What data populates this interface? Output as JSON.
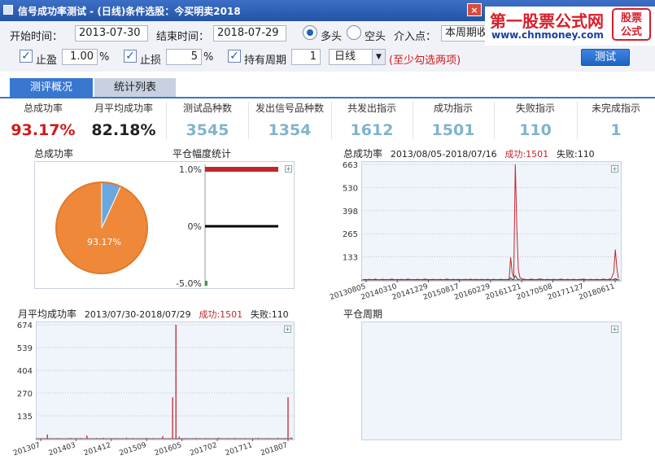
{
  "window": {
    "title": "信号成功率测试 - (日线)条件选股：今买明卖2018",
    "close_glyph": "×"
  },
  "logo": {
    "name": "第一股票公式网",
    "url": "www.chnmoney.com",
    "stamp_l1": "股票",
    "stamp_l2": "公式"
  },
  "form": {
    "start_label": "开始时间：",
    "start_value": "2013-07-30",
    "end_label": "结束时间：",
    "end_value": "2018-07-29",
    "long_label": "多头",
    "short_label": "空头",
    "entry_label": "介入点：",
    "entry_value": "本周期收",
    "take_profit_label": "止盈",
    "take_profit_value": "1.00",
    "take_profit_unit": "%",
    "stop_loss_label": "止损",
    "stop_loss_value": "5",
    "stop_loss_unit": "%",
    "hold_label": "持有周期",
    "hold_value": "1",
    "period_value": "日线",
    "note": "(至少勾选两项)",
    "test_button": "测试",
    "check_mark": "✓",
    "dropdown_glyph": "▼"
  },
  "tabs": [
    {
      "label": "测评概况"
    },
    {
      "label": "统计列表"
    }
  ],
  "stats": [
    {
      "label": "总成功率",
      "value": "93.17%",
      "color": "#d11a1a"
    },
    {
      "label": "月平均成功率",
      "value": "82.18%",
      "color": "#222222"
    },
    {
      "label": "测试品种数",
      "value": "3545",
      "color": "#7fb4cf"
    },
    {
      "label": "发出信号品种数",
      "value": "1354",
      "color": "#7fb4cf"
    },
    {
      "label": "共发出指示",
      "value": "1612",
      "color": "#7fb4cf"
    },
    {
      "label": "成功指示",
      "value": "1501",
      "color": "#7fb4cf"
    },
    {
      "label": "失败指示",
      "value": "110",
      "color": "#7fb4cf"
    },
    {
      "label": "未完成指示",
      "value": "1",
      "color": "#7fb4cf"
    }
  ],
  "panels": {
    "pie_title": "总成功率",
    "range_title": "平仓幅度统计",
    "daily_title": "总成功率",
    "daily_range": "2013/08/05-2018/07/16",
    "monthly_title": "月平均成功率",
    "monthly_range": "2013/07/30-2018/07/29",
    "success_label": "成功:1501",
    "fail_label": "失败:110",
    "period_title": "平仓周期",
    "plus_glyph": "+"
  },
  "chart_data": [
    {
      "type": "pie",
      "categories": [
        "成功",
        "失败"
      ],
      "values": [
        93.17,
        6.83
      ],
      "colors": [
        "#f0883a",
        "#6aa7de"
      ],
      "label": "93.17%"
    },
    {
      "type": "bar",
      "title": "平仓幅度统计",
      "y_ticks": [
        "1.0%",
        "0%",
        "-5.0%"
      ],
      "series": [
        {
          "values": [
            1.0,
            0,
            -5.0
          ]
        }
      ],
      "colors": [
        "#c0272d",
        "#000000",
        "#2ea043"
      ]
    },
    {
      "type": "line",
      "title": "总成功率",
      "y_ticks": [
        663,
        530,
        398,
        265,
        133
      ],
      "ylim": [
        0,
        663
      ],
      "x_ticks": [
        "20130805",
        "20140310",
        "20141229",
        "20150817",
        "20160229",
        "20161121",
        "20170508",
        "20171127",
        "20180611"
      ],
      "series": [
        {
          "name": "成功",
          "color": "#c0272d",
          "values": [
            2,
            3,
            3,
            2,
            4,
            3,
            2,
            3,
            5,
            3,
            2,
            2,
            3,
            4,
            3,
            2,
            3,
            2,
            4,
            5,
            3,
            2,
            3,
            3,
            2,
            4,
            3,
            2,
            3,
            5,
            4,
            3,
            2,
            3,
            2,
            4,
            3,
            3,
            2,
            3,
            5,
            4,
            3,
            2,
            3,
            3,
            4,
            2,
            3,
            2,
            4,
            3,
            2,
            3,
            4,
            5,
            3,
            2,
            3,
            4,
            2,
            3,
            4,
            3,
            2,
            3,
            3,
            4,
            2,
            3,
            5,
            3,
            2,
            4,
            3,
            3,
            2,
            4,
            3,
            2,
            3,
            4,
            3,
            2,
            3,
            4,
            3,
            2,
            3,
            3,
            4,
            3,
            2,
            3,
            3,
            2,
            130,
            40,
            15,
            663,
            300,
            60,
            15,
            8,
            5,
            4,
            3,
            2,
            3,
            5,
            4,
            3,
            2,
            3,
            4,
            6,
            5,
            3,
            2,
            3,
            4,
            3,
            2,
            3,
            4,
            3,
            2,
            3,
            4,
            5,
            3,
            2,
            3,
            4,
            3,
            2,
            3,
            4,
            3,
            2,
            3,
            4,
            3,
            5,
            4,
            3,
            2,
            3,
            4,
            3,
            2,
            3,
            4,
            3,
            2,
            3,
            5,
            4,
            3,
            2,
            5,
            4,
            20,
            45,
            175,
            70,
            10
          ]
        },
        {
          "name": "失败",
          "color": "#444444",
          "values": [
            1,
            0,
            1,
            0,
            1,
            1,
            0,
            1,
            0,
            1,
            0,
            1,
            1,
            0,
            1,
            0,
            1,
            1,
            0,
            1,
            0,
            1,
            0,
            1,
            1,
            0,
            1,
            0,
            1,
            0,
            1,
            1,
            0,
            1,
            0,
            1,
            0,
            1,
            1,
            0,
            1,
            0,
            1,
            0,
            1,
            1,
            0,
            1,
            0,
            1,
            0,
            1,
            1,
            0,
            1,
            0,
            1,
            0,
            1,
            1,
            0,
            1,
            0,
            1,
            0,
            1,
            1,
            0,
            1,
            0,
            1,
            0,
            1,
            1,
            0,
            1,
            0,
            1,
            0,
            1,
            1,
            0,
            1,
            0,
            1,
            0,
            1,
            1,
            0,
            1,
            0,
            1,
            0,
            12,
            5,
            2,
            25,
            10,
            3,
            1,
            0,
            1,
            0,
            1,
            1,
            0,
            1,
            0,
            1,
            0,
            1,
            1,
            0,
            1,
            0,
            1,
            0,
            1,
            1,
            0,
            1,
            0,
            1,
            0,
            1,
            1,
            0,
            1,
            0,
            1,
            0,
            1,
            1,
            0,
            1,
            0,
            1,
            0,
            1,
            1,
            0,
            1,
            0,
            1,
            0,
            1,
            1,
            0,
            1,
            0,
            1,
            0,
            1,
            1,
            0,
            1,
            0,
            1,
            3,
            8,
            4,
            1
          ]
        }
      ]
    },
    {
      "type": "bar",
      "title": "月平均成功率",
      "y_ticks": [
        674,
        539,
        404,
        270,
        135
      ],
      "ylim": [
        0,
        674
      ],
      "x_ticks": [
        "201307",
        "201403",
        "201412",
        "201509",
        "201605",
        "201702",
        "201711",
        "201807"
      ],
      "series": [
        {
          "name": "成功",
          "color": "#c0272d",
          "values": [
            2,
            3,
            2,
            25,
            3,
            2,
            4,
            3,
            2,
            3,
            5,
            2,
            3,
            4,
            2,
            18,
            3,
            2,
            4,
            3,
            5,
            2,
            3,
            2,
            4,
            3,
            2,
            6,
            3,
            4,
            2,
            3,
            2,
            5,
            3,
            4,
            2,
            3,
            15,
            2,
            3,
            245,
            674,
            12,
            3,
            4,
            2,
            3,
            5,
            3,
            2,
            4,
            3,
            2,
            3,
            6,
            3,
            2,
            4,
            3,
            5,
            2,
            3,
            4,
            3,
            2,
            3,
            5,
            2,
            3,
            4,
            3,
            2,
            5,
            3,
            4,
            245,
            8
          ]
        }
      ]
    },
    {
      "type": "line",
      "title": "平仓周期",
      "series": []
    }
  ]
}
